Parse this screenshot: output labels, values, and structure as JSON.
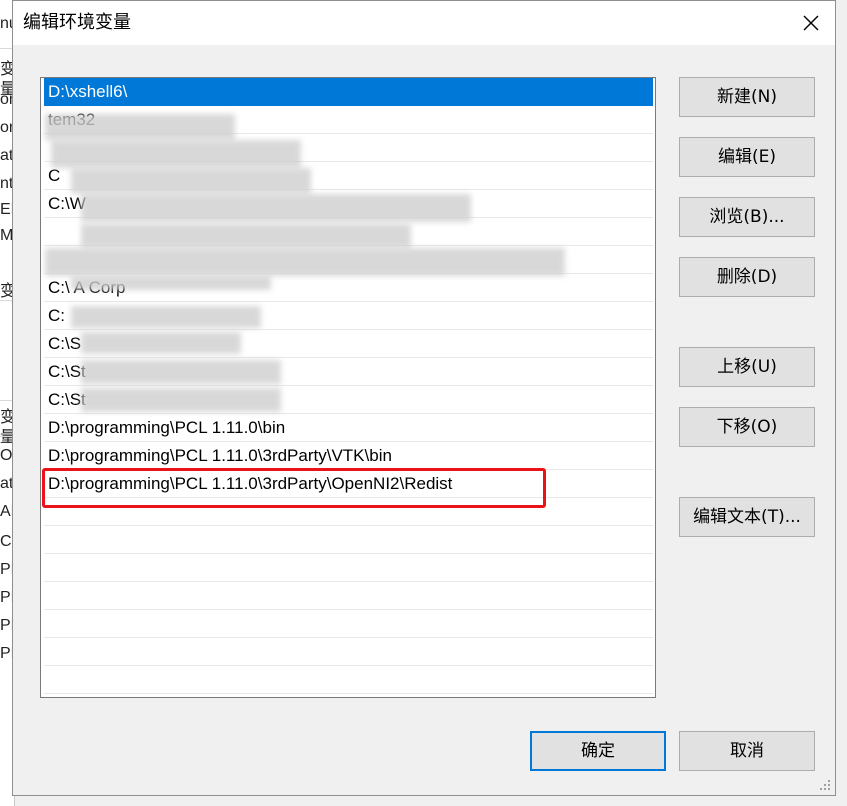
{
  "window": {
    "title": "编辑环境变量",
    "close_glyph": "✕"
  },
  "background": {
    "letters": [
      "nu",
      "变量",
      "on",
      "on",
      "at",
      "nt",
      "EN",
      "Mi",
      "变",
      "变量",
      "OS",
      "at",
      "AL",
      "CO",
      "PR",
      "PR",
      "PR",
      "PR"
    ]
  },
  "list": {
    "items": [
      {
        "text": "D:\\xshell6\\",
        "selected": true
      },
      {
        "text": "tem32",
        "selected": false
      },
      {
        "text": "",
        "selected": false
      },
      {
        "text": "C",
        "selected": false
      },
      {
        "text": "C:\\W",
        "selected": false
      },
      {
        "text": "",
        "selected": false
      },
      {
        "text": "",
        "selected": false
      },
      {
        "text": "C:\\                      A Corp",
        "selected": false
      },
      {
        "text": "C:",
        "selected": false
      },
      {
        "text": "C:\\S",
        "selected": false
      },
      {
        "text": "C:\\St",
        "selected": false
      },
      {
        "text": "C:\\St",
        "selected": false
      },
      {
        "text": "D:\\programming\\PCL 1.11.0\\bin",
        "selected": false
      },
      {
        "text": "D:\\programming\\PCL 1.11.0\\3rdParty\\VTK\\bin",
        "selected": false
      },
      {
        "text": "D:\\programming\\PCL 1.11.0\\3rdParty\\OpenNI2\\Redist",
        "selected": false
      },
      {
        "text": "",
        "selected": false
      },
      {
        "text": "",
        "selected": false
      },
      {
        "text": "",
        "selected": false
      },
      {
        "text": "",
        "selected": false
      },
      {
        "text": "",
        "selected": false
      },
      {
        "text": "",
        "selected": false
      },
      {
        "text": "",
        "selected": false
      }
    ]
  },
  "buttons": {
    "new": "新建(N)",
    "edit": "编辑(E)",
    "browse": "浏览(B)...",
    "delete": "删除(D)",
    "move_up": "上移(U)",
    "move_down": "下移(O)",
    "edit_text": "编辑文本(T)...",
    "ok": "确定",
    "cancel": "取消"
  },
  "colors": {
    "selection": "#0078d7",
    "highlight": "#e8141a"
  }
}
